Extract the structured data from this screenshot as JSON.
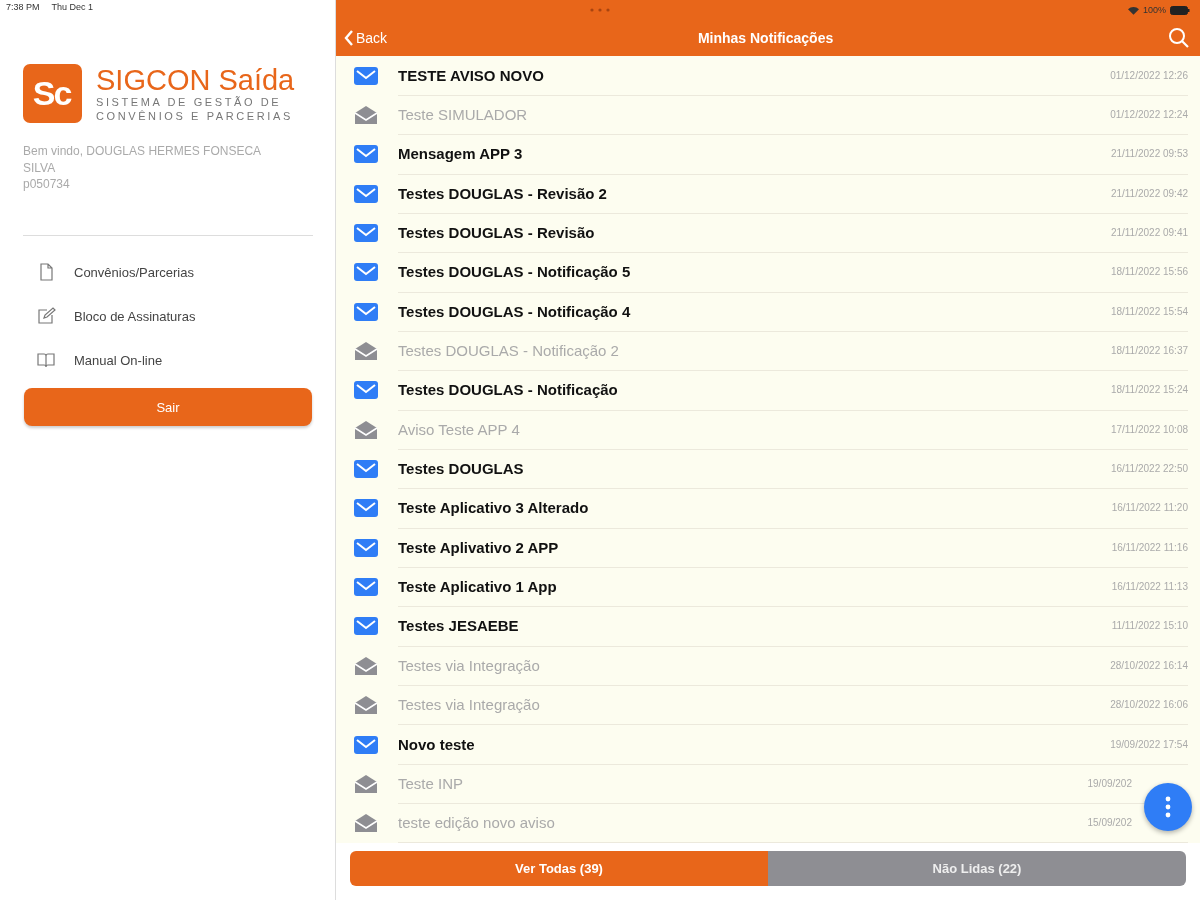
{
  "status_bar": {
    "time": "7:38 PM",
    "date": "Thu Dec 1",
    "battery": "100%"
  },
  "sidebar": {
    "logo": {
      "mark": "Sc",
      "title": "SIGCON Saída",
      "subtitle_1": "SISTEMA DE GESTÃO DE",
      "subtitle_2": "CONVÊNIOS E PARCERIAS"
    },
    "welcome": "Bem vindo, DOUGLAS HERMES FONSECA SILVA",
    "user_id": "p050734",
    "items": [
      {
        "kind": "document",
        "label": "Convênios/Parcerias"
      },
      {
        "kind": "edit",
        "label": "Bloco de Assinaturas"
      },
      {
        "kind": "book",
        "label": "Manual On-line"
      }
    ],
    "logout_button": "Sair"
  },
  "nav": {
    "back": "Back",
    "title": "Minhas Notificações"
  },
  "notifications": [
    {
      "title": "TESTE AVISO NOVO",
      "date": "01/12/2022 12:26",
      "read": false
    },
    {
      "title": "Teste SIMULADOR",
      "date": "01/12/2022 12:24",
      "read": true
    },
    {
      "title": "Mensagem APP 3",
      "date": "21/11/2022 09:53",
      "read": false
    },
    {
      "title": "Testes DOUGLAS - Revisão 2",
      "date": "21/11/2022 09:42",
      "read": false
    },
    {
      "title": "Testes DOUGLAS - Revisão",
      "date": "21/11/2022 09:41",
      "read": false
    },
    {
      "title": "Testes DOUGLAS - Notificação 5",
      "date": "18/11/2022 15:56",
      "read": false
    },
    {
      "title": "Testes DOUGLAS - Notificação 4",
      "date": "18/11/2022 15:54",
      "read": false
    },
    {
      "title": "Testes DOUGLAS - Notificação 2",
      "date": "18/11/2022 16:37",
      "read": true
    },
    {
      "title": "Testes DOUGLAS - Notificação",
      "date": "18/11/2022 15:24",
      "read": false
    },
    {
      "title": "Aviso Teste APP 4",
      "date": "17/11/2022 10:08",
      "read": true
    },
    {
      "title": "Testes DOUGLAS",
      "date": "16/11/2022 22:50",
      "read": false
    },
    {
      "title": "Teste Aplicativo 3 Alterado",
      "date": "16/11/2022 11:20",
      "read": false
    },
    {
      "title": "Teste Aplivativo 2 APP",
      "date": "16/11/2022 11:16",
      "read": false
    },
    {
      "title": "Teste Aplicativo 1 App",
      "date": "16/11/2022 11:13",
      "read": false
    },
    {
      "title": "Testes JESAEBE",
      "date": "11/11/2022 15:10",
      "read": false
    },
    {
      "title": "Testes via Integração",
      "date": "28/10/2022 16:14",
      "read": true
    },
    {
      "title": "Testes via Integração",
      "date": "28/10/2022 16:06",
      "read": true
    },
    {
      "title": "Novo teste",
      "date": "19/09/2022 17:54",
      "read": false
    },
    {
      "title": "Teste INP",
      "date": "19/09/202",
      "read": true
    },
    {
      "title": "teste edição novo aviso",
      "date": "15/09/202",
      "read": true
    }
  ],
  "filters": [
    {
      "label": "Ver Todas (39)",
      "selected": true
    },
    {
      "label": "Não Lidas (22)",
      "selected": false
    }
  ]
}
